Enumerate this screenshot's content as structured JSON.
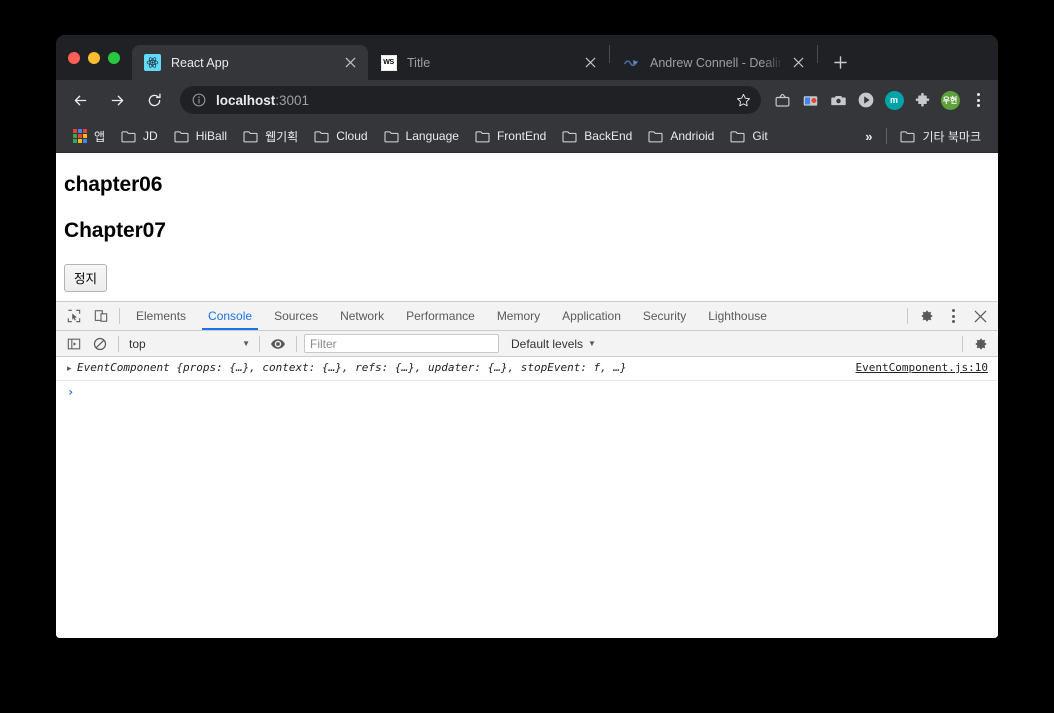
{
  "browser": {
    "tabs": [
      {
        "title": "React App",
        "favicon": "react-icon",
        "active": true
      },
      {
        "title": "Title",
        "favicon": "webstorm-icon",
        "active": false
      },
      {
        "title": "Andrew Connell - Dealing with",
        "favicon": "site-icon",
        "active": false
      }
    ],
    "new_tab_label": "+",
    "toolbar": {
      "back_label": "←",
      "forward_label": "→",
      "reload_label": "↻",
      "url_host": "localhost",
      "url_port": ":3001",
      "info_icon": "info-circle-icon",
      "star_icon": "bookmark-star-icon",
      "extensions": [
        {
          "name": "tv-extension-icon",
          "glyph": "tv"
        },
        {
          "name": "chrome-remote-desktop-icon",
          "glyph": "window"
        },
        {
          "name": "camera-extension-icon",
          "glyph": "camera"
        },
        {
          "name": "play-extension-icon",
          "glyph": "play"
        },
        {
          "name": "m-extension-icon",
          "glyph": "m",
          "color": "#00a3a8"
        },
        {
          "name": "puzzle-extensions-icon",
          "glyph": "puzzle"
        },
        {
          "name": "profile-avatar",
          "glyph": "우현",
          "color": "#5ea03c"
        }
      ],
      "menu_icon": "three-dot-menu-icon"
    },
    "bookmarks": {
      "apps_label": "앱",
      "items": [
        {
          "label": "JD"
        },
        {
          "label": "HiBall"
        },
        {
          "label": "웹기획"
        },
        {
          "label": "Cloud"
        },
        {
          "label": "Language"
        },
        {
          "label": "FrontEnd"
        },
        {
          "label": "BackEnd"
        },
        {
          "label": "Andrioid"
        },
        {
          "label": "Git"
        }
      ],
      "overflow_label": "»",
      "other_label": "기타 북마크"
    }
  },
  "page": {
    "heading1": "chapter06",
    "heading2": "Chapter07",
    "stop_button": "정지"
  },
  "devtools": {
    "inspect_icon": "inspect-element-icon",
    "device_icon": "toggle-device-toolbar-icon",
    "tabs": [
      {
        "label": "Elements",
        "active": false
      },
      {
        "label": "Console",
        "active": true
      },
      {
        "label": "Sources",
        "active": false
      },
      {
        "label": "Network",
        "active": false
      },
      {
        "label": "Performance",
        "active": false
      },
      {
        "label": "Memory",
        "active": false
      },
      {
        "label": "Application",
        "active": false
      },
      {
        "label": "Security",
        "active": false
      },
      {
        "label": "Lighthouse",
        "active": false
      }
    ],
    "settings_icon": "settings-gear-icon",
    "more_icon": "more-options-icon",
    "close_icon": "close-devtools-icon",
    "console": {
      "sidebar_icon": "console-sidebar-icon",
      "clear_icon": "clear-console-icon",
      "context": "top",
      "context_caret": "▼",
      "eye_icon": "live-expression-icon",
      "filter_placeholder": "Filter",
      "filter_value": "",
      "levels_label": "Default levels",
      "levels_caret": "▼",
      "console_settings_icon": "console-settings-gear-icon",
      "messages": [
        {
          "expand_arrow": "▸",
          "text": "EventComponent {props: {…}, context: {…}, refs: {…}, updater: {…}, stopEvent: f, …}",
          "source": "EventComponent.js:10"
        }
      ],
      "prompt_caret": "›"
    }
  }
}
